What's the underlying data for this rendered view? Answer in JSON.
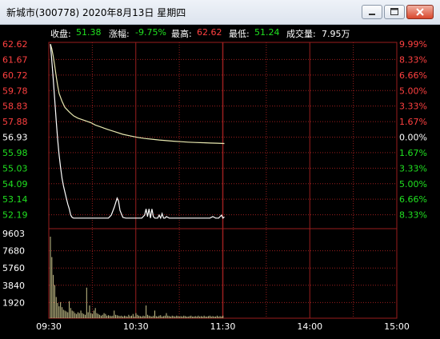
{
  "window": {
    "title": "新城市(300778)    2020年8月13日    星期四",
    "buttons": {
      "minimize": "minimize-icon",
      "maximize": "maximize-icon",
      "close": "close-icon"
    }
  },
  "info": {
    "close_label": "收盘:",
    "close_value": "51.38",
    "change_label": "涨幅:",
    "change_value": "-9.75%",
    "high_label": "最高:",
    "high_value": "62.62",
    "low_label": "最低:",
    "low_value": "51.24",
    "volume_label": "成交量:",
    "volume_value": "7.95万"
  },
  "colors": {
    "background": "#000000",
    "up": "#ff4040",
    "down": "#20e020",
    "flat": "#ffffff",
    "grid": "#9a1e1e",
    "price_line": "#ffffff",
    "avg_line": "#e8e8b0",
    "volume": "#c8c28a"
  },
  "chart_data": [
    {
      "type": "line",
      "title": "",
      "ylim": [
        51.24,
        62.62
      ],
      "base_price": 56.93,
      "price_ticks": [
        "62.62",
        "61.67",
        "60.72",
        "59.78",
        "58.83",
        "57.88",
        "56.93",
        "55.98",
        "55.03",
        "54.09",
        "53.14",
        "52.19"
      ],
      "pct_ticks": [
        "9.99%",
        "8.33%",
        "6.66%",
        "5.00%",
        "3.33%",
        "1.67%",
        "0.00%",
        "1.67%",
        "3.33%",
        "5.00%",
        "6.66%",
        "8.33%"
      ],
      "x_ticks": [
        "09:30",
        "10:30",
        "11:30",
        "14:00",
        "15:00"
      ],
      "series": [
        {
          "x": [
            0,
            1,
            2,
            3,
            4,
            5,
            6,
            8,
            10,
            13,
            16,
            19,
            22,
            25,
            28,
            31,
            34,
            37,
            40,
            45,
            50,
            55,
            60,
            65,
            70,
            75,
            80,
            85,
            90,
            95,
            100,
            105,
            110,
            115,
            120
          ],
          "y": [
            62.62,
            62.3,
            61.8,
            61.2,
            60.5,
            59.9,
            59.4,
            58.9,
            58.5,
            58.2,
            57.95,
            57.8,
            57.7,
            57.6,
            57.5,
            57.35,
            57.25,
            57.15,
            57.05,
            56.9,
            56.75,
            56.65,
            56.55,
            56.48,
            56.43,
            56.38,
            56.34,
            56.3,
            56.27,
            56.24,
            56.22,
            56.2,
            56.18,
            56.17,
            56.15
          ]
        },
        {
          "x": [
            0,
            1,
            2,
            3,
            4,
            5,
            6,
            7,
            8,
            9,
            10,
            11,
            12,
            13,
            14,
            15,
            16,
            17,
            18,
            20,
            25,
            30,
            35,
            40,
            42,
            44,
            46,
            47,
            48,
            50,
            52,
            55,
            60,
            63,
            65,
            66,
            67,
            68,
            69,
            70,
            71,
            72,
            73,
            74,
            75,
            76,
            77,
            78,
            79,
            80,
            82,
            84,
            86,
            88,
            90,
            95,
            100,
            105,
            108,
            110,
            112,
            114,
            116,
            118,
            119,
            120
          ],
          "y": [
            62.6,
            61.5,
            60.3,
            59.0,
            57.6,
            56.4,
            55.4,
            54.6,
            53.9,
            53.4,
            53.0,
            52.6,
            52.2,
            51.9,
            51.5,
            51.35,
            51.3,
            51.3,
            51.3,
            51.3,
            51.3,
            51.3,
            51.3,
            51.3,
            51.5,
            52.0,
            52.6,
            52.4,
            51.8,
            51.35,
            51.3,
            51.3,
            51.3,
            51.3,
            51.5,
            51.9,
            51.4,
            51.9,
            51.3,
            51.9,
            51.4,
            51.3,
            51.3,
            51.3,
            51.5,
            51.3,
            51.6,
            51.3,
            51.3,
            51.4,
            51.3,
            51.3,
            51.3,
            51.3,
            51.3,
            51.3,
            51.3,
            51.3,
            51.3,
            51.3,
            51.4,
            51.3,
            51.3,
            51.5,
            51.3,
            51.38
          ]
        }
      ]
    },
    {
      "type": "bar",
      "ylim": [
        0,
        9603
      ],
      "y_ticks": [
        "9603",
        "7680",
        "5760",
        "3840",
        "1920"
      ],
      "values": [
        9603,
        7200,
        5100,
        3900,
        2500,
        1800,
        1400,
        1900,
        1300,
        1000,
        900,
        800,
        700,
        2000,
        1200,
        900,
        800,
        600,
        500,
        700,
        600,
        900,
        600,
        500,
        400,
        3600,
        700,
        1500,
        600,
        500,
        900,
        1200,
        600,
        500,
        400,
        300,
        400,
        600,
        500,
        300,
        350,
        300,
        250,
        300,
        900,
        400,
        350,
        300,
        250,
        300,
        200,
        300,
        250,
        200,
        400,
        250,
        300,
        500,
        200,
        600,
        400,
        300,
        250,
        200,
        300,
        250,
        1500,
        400,
        300,
        250,
        200,
        300,
        900,
        250,
        200,
        300,
        350,
        200,
        250,
        300,
        600,
        300,
        250,
        200,
        300,
        250,
        200,
        300,
        250,
        200,
        250,
        200,
        300,
        250,
        200,
        200,
        250,
        300,
        200,
        200,
        250,
        200,
        300,
        200,
        250,
        200,
        300,
        200,
        200,
        250,
        300,
        200,
        250,
        200,
        200,
        300,
        200,
        250,
        200,
        300
      ]
    }
  ]
}
